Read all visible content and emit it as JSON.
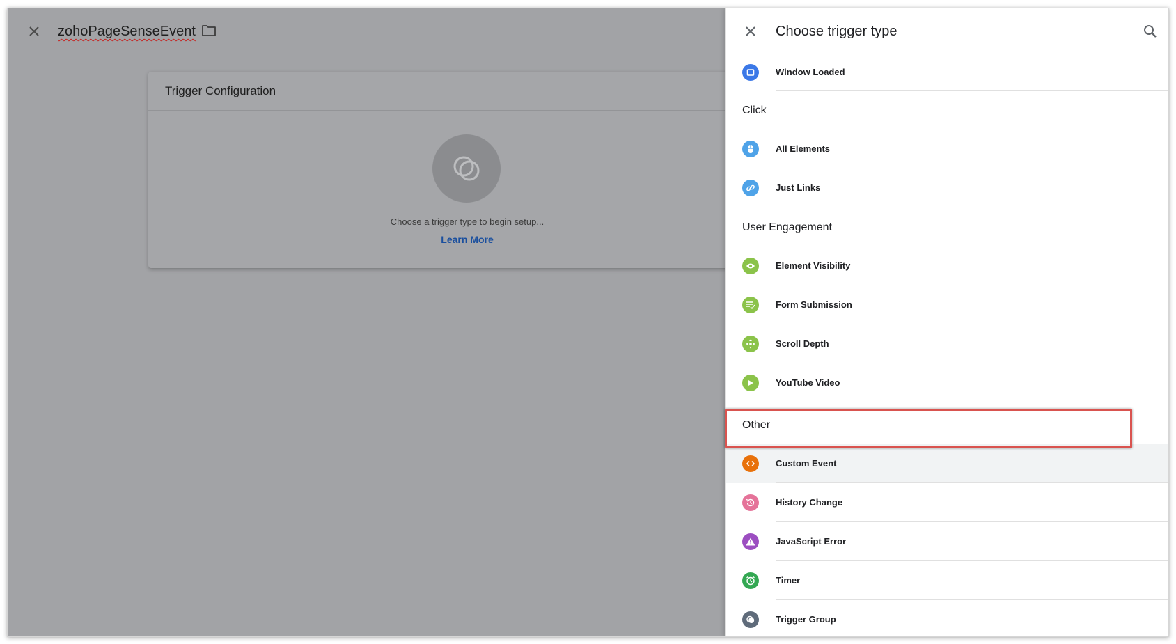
{
  "editor": {
    "title": "zohoPageSenseEvent",
    "card_title": "Trigger Configuration",
    "placeholder_text": "Choose a trigger type to begin setup...",
    "learn_more": "Learn More"
  },
  "panel": {
    "title": "Choose trigger type",
    "sections": [
      {
        "label": "",
        "items": [
          {
            "label": "Window Loaded",
            "icon": "window-icon",
            "color": "#3b78e7"
          }
        ]
      },
      {
        "label": "Click",
        "items": [
          {
            "label": "All Elements",
            "icon": "mouse-icon",
            "color": "#4fa3e8"
          },
          {
            "label": "Just Links",
            "icon": "link-icon",
            "color": "#4fa3e8"
          }
        ]
      },
      {
        "label": "User Engagement",
        "items": [
          {
            "label": "Element Visibility",
            "icon": "eye-icon",
            "color": "#8bc34a"
          },
          {
            "label": "Form Submission",
            "icon": "form-icon",
            "color": "#8bc34a"
          },
          {
            "label": "Scroll Depth",
            "icon": "scroll-icon",
            "color": "#8bc34a"
          },
          {
            "label": "YouTube Video",
            "icon": "play-icon",
            "color": "#8bc34a"
          }
        ]
      },
      {
        "label": "Other",
        "items": [
          {
            "label": "Custom Event",
            "icon": "code-icon",
            "color": "#e8710a",
            "highlighted": true
          },
          {
            "label": "History Change",
            "icon": "history-icon",
            "color": "#e57399"
          },
          {
            "label": "JavaScript Error",
            "icon": "warning-icon",
            "color": "#9c4ec1"
          },
          {
            "label": "Timer",
            "icon": "timer-icon",
            "color": "#34a853"
          },
          {
            "label": "Trigger Group",
            "icon": "trigger-group-icon",
            "color": "#5f6b7a"
          }
        ]
      }
    ]
  }
}
